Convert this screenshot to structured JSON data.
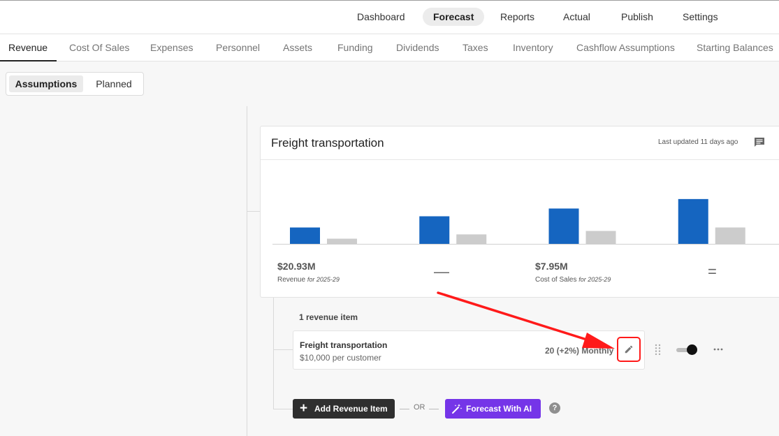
{
  "top_nav": {
    "items": [
      {
        "label": "Dashboard"
      },
      {
        "label": "Forecast",
        "active": true
      },
      {
        "label": "Reports"
      },
      {
        "label": "Actual"
      },
      {
        "label": "Publish"
      },
      {
        "label": "Settings"
      }
    ]
  },
  "sub_nav": {
    "items": [
      {
        "label": "Revenue",
        "active": true
      },
      {
        "label": "Cost Of Sales"
      },
      {
        "label": "Expenses"
      },
      {
        "label": "Personnel"
      },
      {
        "label": "Assets"
      },
      {
        "label": "Funding"
      },
      {
        "label": "Dividends"
      },
      {
        "label": "Taxes"
      },
      {
        "label": "Inventory"
      },
      {
        "label": "Cashflow Assumptions"
      },
      {
        "label": "Starting Balances"
      }
    ]
  },
  "view_toggle": {
    "assumptions": "Assumptions",
    "planned": "Planned",
    "selected": "Assumptions"
  },
  "card": {
    "title": "Freight transportation",
    "last_updated": "Last updated 11 days ago",
    "comment_icon": "comment-icon"
  },
  "chart_data": {
    "type": "bar",
    "categories": [
      "",
      "",
      "",
      ""
    ],
    "series": [
      {
        "values": [
          19,
          32,
          41,
          52
        ],
        "color": "#1565c0"
      },
      {
        "values": [
          6,
          11,
          15,
          19
        ],
        "color": "#cccccc"
      }
    ],
    "ylim": [
      0,
      60
    ],
    "grid": false
  },
  "stats": {
    "revenue_value": "$20.93M",
    "revenue_label": "Revenue",
    "revenue_period": "for 2025-29",
    "minus": "—",
    "cos_value": "$7.95M",
    "cos_label": "Cost of Sales",
    "cos_period": "for 2025-29",
    "equals": "="
  },
  "items": {
    "count_label": "1 revenue item",
    "rows": [
      {
        "name": "Freight transportation",
        "subtitle": "$10,000 per customer",
        "growth": "20 (+2%) Monthly",
        "enabled": true
      }
    ]
  },
  "actions": {
    "add_label": "Add Revenue Item",
    "or_label": "OR",
    "ai_label": "Forecast With AI",
    "help": "?"
  },
  "colors": {
    "accent_blue": "#1565c0",
    "ai_purple": "#7535e8",
    "highlight_red": "#ff1a1a"
  }
}
